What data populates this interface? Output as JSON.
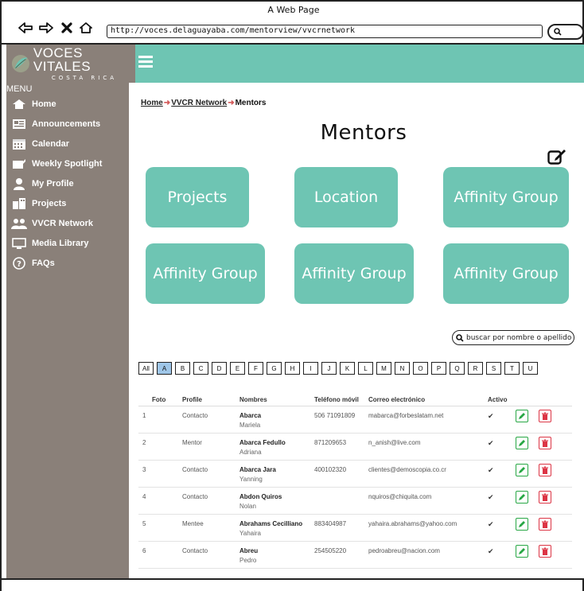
{
  "browser": {
    "title": "A Web Page",
    "url": "http://voces.delaguayaba.com/mentorview/vvcrnetwork"
  },
  "brand": {
    "name": "VOCES VITALES",
    "sub": "COSTA RICA",
    "accent": "#6ec5b3",
    "sidebar_bg": "#8a8079"
  },
  "sidebar": {
    "menu_label": "MENU",
    "items": [
      {
        "label": "Home",
        "icon": "home-icon"
      },
      {
        "label": "Announcements",
        "icon": "announcement-icon"
      },
      {
        "label": "Calendar",
        "icon": "calendar-icon"
      },
      {
        "label": "Weekly Spotlight",
        "icon": "spotlight-icon"
      },
      {
        "label": "My Profile",
        "icon": "profile-icon"
      },
      {
        "label": "Projects",
        "icon": "projects-icon"
      },
      {
        "label": "VVCR Network",
        "icon": "network-icon"
      },
      {
        "label": "Media Library",
        "icon": "media-icon"
      },
      {
        "label": "FAQs",
        "icon": "question-icon"
      }
    ]
  },
  "breadcrumb": {
    "home": "Home",
    "network": "VVCR Network",
    "current": "Mentors"
  },
  "page": {
    "title": "Mentors",
    "tiles": [
      "Projects",
      "Location",
      "Affinity Group",
      "Affinity Group",
      "Affinity Group",
      "Affinity Group"
    ],
    "search_placeholder": "buscar por nombre o apellido"
  },
  "alphabet": {
    "letters": [
      "All",
      "A",
      "B",
      "C",
      "D",
      "E",
      "F",
      "G",
      "H",
      "I",
      "J",
      "K",
      "L",
      "M",
      "N",
      "O",
      "P",
      "Q",
      "R",
      "S",
      "T",
      "U"
    ],
    "active": "A"
  },
  "table": {
    "headers": {
      "foto": "Foto",
      "profile": "Profile",
      "nombres": "Nombres",
      "telefono": "Teléfono móvil",
      "correo": "Correo electrónico",
      "activo": "Activo"
    },
    "rows": [
      {
        "num": "1",
        "profile": "Contacto",
        "surname": "Abarca",
        "name": "Mariela",
        "phone": "506 71091809",
        "email": "mabarca@forbeslatam.net",
        "active": "✔"
      },
      {
        "num": "2",
        "profile": "Mentor",
        "surname": "Abarca Fedullo",
        "name": "Adriana",
        "phone": "871209653",
        "email": "n_anish@live.com",
        "active": "✔"
      },
      {
        "num": "3",
        "profile": "Contacto",
        "surname": "Abarca Jara",
        "name": "Yanning",
        "phone": "400102320",
        "email": "clientes@demoscopia.co.cr",
        "active": "✔"
      },
      {
        "num": "4",
        "profile": "Contacto",
        "surname": "Abdon Quiros",
        "name": "Nolan",
        "phone": "",
        "email": "nquiros@chiquita.com",
        "active": "✔"
      },
      {
        "num": "5",
        "profile": "Mentee",
        "surname": "Abrahams Cecilliano",
        "name": "Yahaira",
        "phone": "883404987",
        "email": "yahaira.abrahams@yahoo.com",
        "active": "✔"
      },
      {
        "num": "6",
        "profile": "Contacto",
        "surname": "Abreu",
        "name": "Pedro",
        "phone": "254505220",
        "email": "pedroabreu@nacion.com",
        "active": "✔"
      }
    ]
  }
}
